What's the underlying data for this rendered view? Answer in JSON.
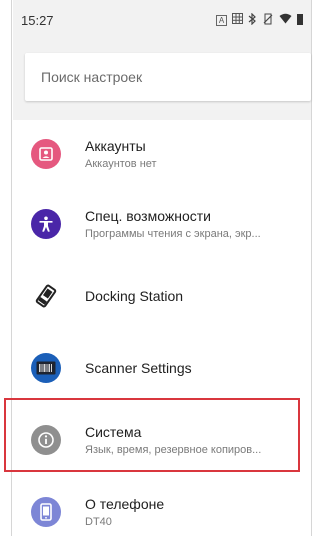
{
  "statusbar": {
    "time": "15:27",
    "icons": {
      "a": "A"
    }
  },
  "search": {
    "placeholder": "Поиск настроек"
  },
  "items": [
    {
      "title": "Аккаунты",
      "subtitle": "Аккаунтов нет",
      "icon": "account-icon",
      "color": "#e5587f"
    },
    {
      "title": "Спец. возможности",
      "subtitle": "Программы чтения с экрана, экр...",
      "icon": "accessibility-icon",
      "color": "#4a26a8"
    },
    {
      "title": "Docking Station",
      "subtitle": "",
      "icon": "docking-station-icon",
      "color": "#222222"
    },
    {
      "title": "Scanner Settings",
      "subtitle": "",
      "icon": "scanner-icon",
      "color": "#1b5fb8"
    },
    {
      "title": "Система",
      "subtitle": "Язык, время, резервное копиров...",
      "icon": "system-info-icon",
      "color": "#8f8f8f"
    },
    {
      "title": "О телефоне",
      "subtitle": "DT40",
      "icon": "phone-icon",
      "color": "#7d86d6"
    }
  ],
  "colors": {
    "highlight": "#d9363e",
    "status_bg": "#f2f2f2"
  }
}
